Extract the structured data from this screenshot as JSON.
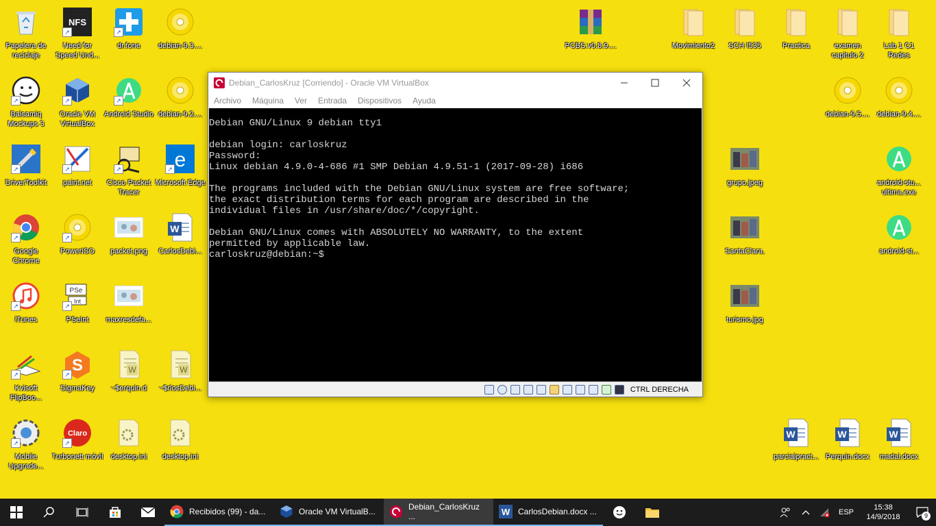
{
  "desktop_icons": [
    {
      "label": "Papelera de reciclaje",
      "icon": "recycle-bin-icon",
      "shortcut": false
    },
    {
      "label": "Need for Speed Und...",
      "icon": "nfs-icon",
      "shortcut": true
    },
    {
      "label": "dr.fone",
      "icon": "drfone-icon",
      "shortcut": true
    },
    {
      "label": "debian-9.3....",
      "icon": "disc-image-icon",
      "shortcut": false
    },
    {
      "label": "Balsamiq Mockups 3",
      "icon": "balsamiq-icon",
      "shortcut": true
    },
    {
      "label": "Oracle VM VirtualBox",
      "icon": "virtualbox-icon",
      "shortcut": true
    },
    {
      "label": "Android Studio",
      "icon": "android-studio-icon",
      "shortcut": true
    },
    {
      "label": "debian-9.2....",
      "icon": "disc-image-icon",
      "shortcut": false
    },
    {
      "label": "DriverToolkit",
      "icon": "drivertoolkit-icon",
      "shortcut": true
    },
    {
      "label": "paint.net",
      "icon": "paintnet-icon",
      "shortcut": true
    },
    {
      "label": "Cisco Packet Tracer",
      "icon": "packet-tracer-icon",
      "shortcut": true
    },
    {
      "label": "Microsoft Edge",
      "icon": "edge-icon",
      "shortcut": true
    },
    {
      "label": "Google Chrome",
      "icon": "chrome-icon",
      "shortcut": true
    },
    {
      "label": "PowerISO",
      "icon": "poweriso-icon",
      "shortcut": true
    },
    {
      "label": "packet.png",
      "icon": "image-file-icon",
      "shortcut": false
    },
    {
      "label": "CarlosDebi...",
      "icon": "word-doc-icon",
      "shortcut": false
    },
    {
      "label": "iTunes",
      "icon": "itunes-icon",
      "shortcut": true
    },
    {
      "label": "PSeInt",
      "icon": "pseint-icon",
      "shortcut": true
    },
    {
      "label": "maxresdefa...",
      "icon": "image-file-icon",
      "shortcut": false
    },
    {
      "label": "Kvisoft FlipBoo...",
      "icon": "flipbook-icon",
      "shortcut": true
    },
    {
      "label": "SigmaKey",
      "icon": "sigmakey-icon",
      "shortcut": true
    },
    {
      "label": "~$erquin.d",
      "icon": "word-temp-icon",
      "shortcut": false
    },
    {
      "label": "~$rlosDebi...",
      "icon": "word-temp-icon",
      "shortcut": false
    },
    {
      "label": "Mobile Upgrade...",
      "icon": "mobile-upgrade-icon",
      "shortcut": true
    },
    {
      "label": "Turbonett móvil",
      "icon": "claro-icon",
      "shortcut": true
    },
    {
      "label": "desktop.ini",
      "icon": "settings-file-icon",
      "shortcut": false
    },
    {
      "label": "desktop.ini",
      "icon": "settings-file-icon",
      "shortcut": false
    },
    {
      "label": "PCBS.v0.8.9....",
      "icon": "winrar-icon",
      "shortcut": false
    },
    {
      "label": "Movimiento2",
      "icon": "folder-icon",
      "shortcut": false
    },
    {
      "label": "SCH I535",
      "icon": "folder-icon",
      "shortcut": false
    },
    {
      "label": "Practica",
      "icon": "folder-icon",
      "shortcut": false
    },
    {
      "label": "examen capitulo 2",
      "icon": "folder-icon",
      "shortcut": false
    },
    {
      "label": "Lab 1 C1 Redes",
      "icon": "folder-icon",
      "shortcut": false
    },
    {
      "label": "debian-9.5....",
      "icon": "disc-image-icon",
      "shortcut": false
    },
    {
      "label": "debian-9.4....",
      "icon": "disc-image-icon",
      "shortcut": false
    },
    {
      "label": "grupo.jpeg",
      "icon": "photo-icon",
      "shortcut": false
    },
    {
      "label": "android-stu... ultima.exe",
      "icon": "android-studio-icon",
      "shortcut": false
    },
    {
      "label": "SantaClara.",
      "icon": "photo-icon",
      "shortcut": false
    },
    {
      "label": "android-st...",
      "icon": "android-studio-icon",
      "shortcut": false
    },
    {
      "label": "turismo.jpg",
      "icon": "photo-icon",
      "shortcut": false
    },
    {
      "label": "parcialpract...",
      "icon": "word-doc-icon",
      "shortcut": false
    },
    {
      "label": "Perquin.docx",
      "icon": "word-doc-icon",
      "shortcut": false
    },
    {
      "label": "madai.docx",
      "icon": "word-doc-icon",
      "shortcut": false
    }
  ],
  "vbox": {
    "title": "Debian_CarlosKruz [Corriendo] - Oracle VM VirtualBox",
    "menu": [
      "Archivo",
      "Máquina",
      "Ver",
      "Entrada",
      "Dispositivos",
      "Ayuda"
    ],
    "terminal_lines": [
      "Debian GNU/Linux 9 debian tty1",
      "",
      "debian login: carloskruz",
      "Password:",
      "Linux debian 4.9.0-4-686 #1 SMP Debian 4.9.51-1 (2017-09-28) i686",
      "",
      "The programs included with the Debian GNU/Linux system are free software;",
      "the exact distribution terms for each program are described in the",
      "individual files in /usr/share/doc/*/copyright.",
      "",
      "Debian GNU/Linux comes with ABSOLUTELY NO WARRANTY, to the extent",
      "permitted by applicable law.",
      "carloskruz@debian:~$"
    ],
    "host_key": "CTRL DERECHA"
  },
  "taskbar": {
    "apps": [
      {
        "label": "Recibidos (99) - da...",
        "icon": "chrome-icon"
      },
      {
        "label": "Oracle VM VirtualB...",
        "icon": "virtualbox-icon"
      },
      {
        "label": "Debian_CarlosKruz ...",
        "icon": "debian-icon"
      },
      {
        "label": "CarlosDebian.docx ...",
        "icon": "word-icon"
      }
    ],
    "lang": "ESP",
    "time": "15:38",
    "date": "14/9/2018",
    "notif_count": "9"
  }
}
